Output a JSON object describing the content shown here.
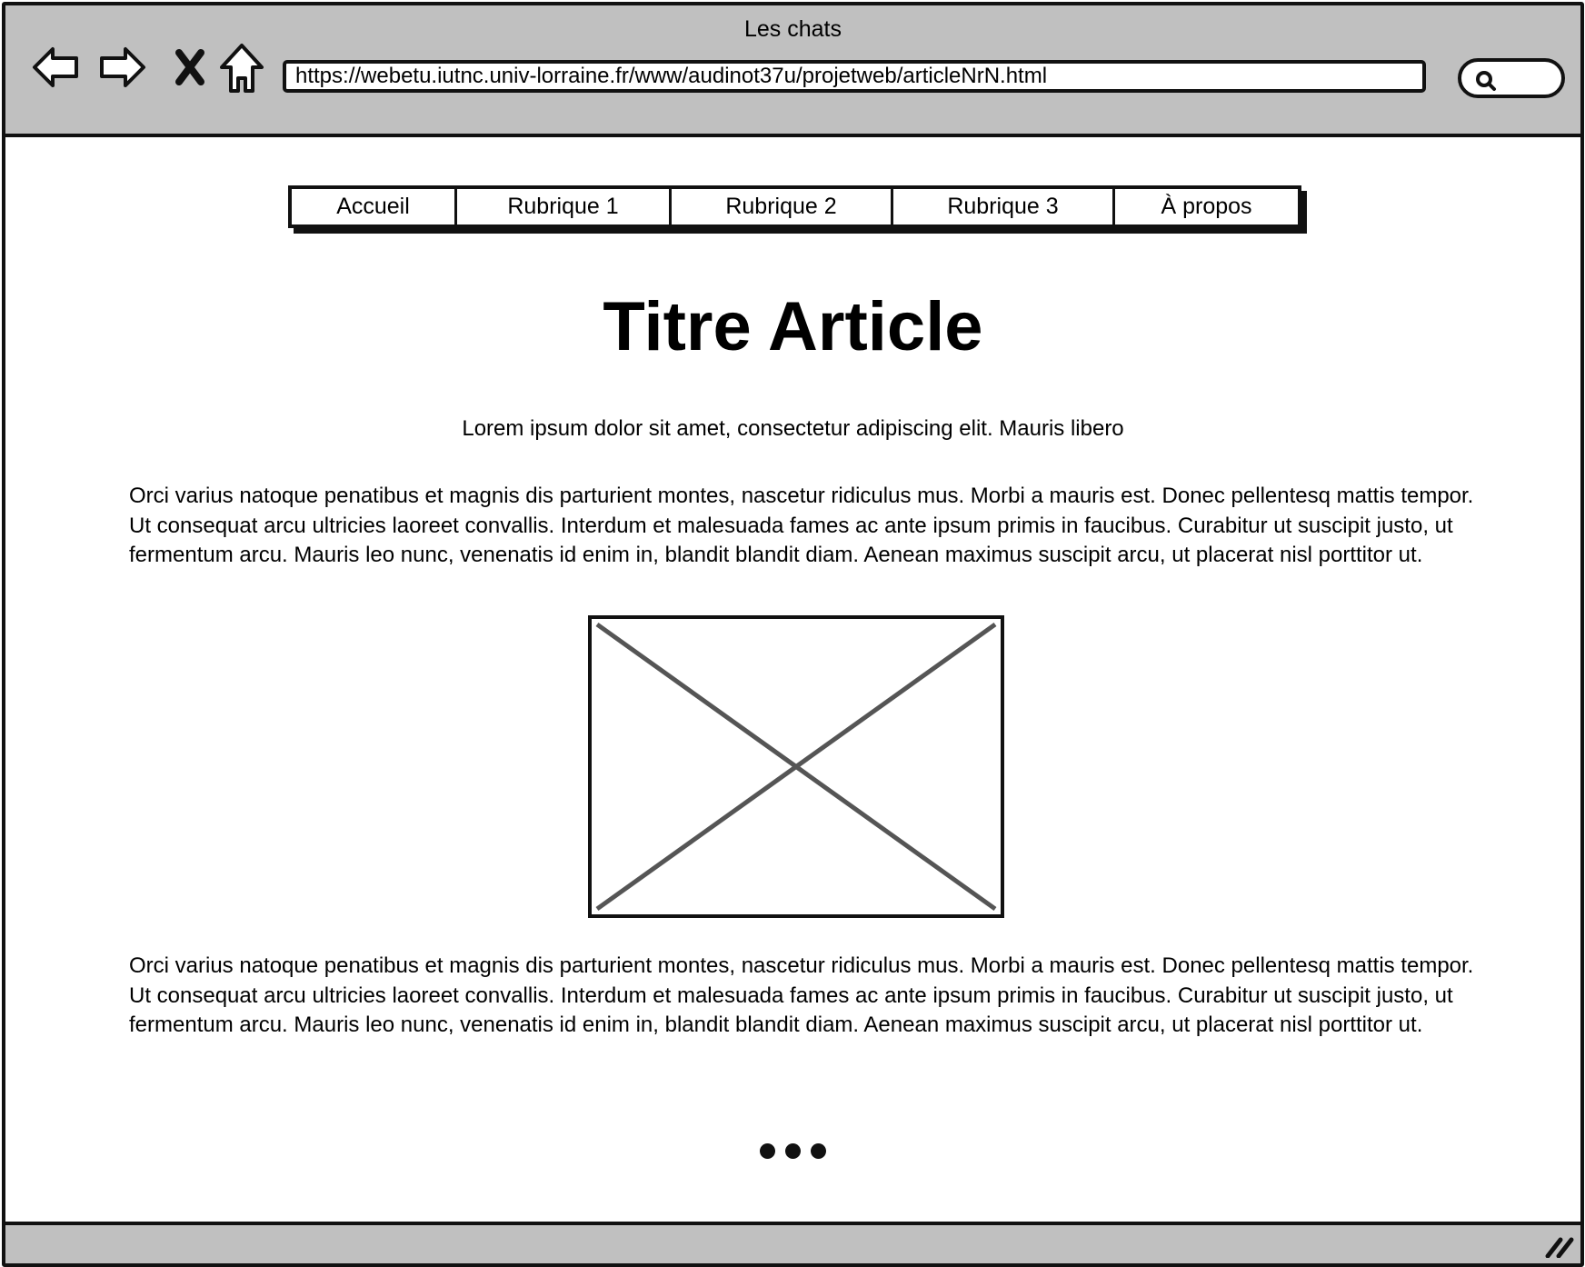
{
  "browser": {
    "window_title": "Les chats",
    "url": "https://webetu.iutnc.univ-lorraine.fr/www/audinot37u/projetweb/articleNrN.html",
    "icons": [
      "back-arrow-icon",
      "forward-arrow-icon",
      "close-icon",
      "home-icon",
      "search-icon",
      "resize-grip-icon"
    ]
  },
  "menu": {
    "items": [
      {
        "label": "Accueil"
      },
      {
        "label": "Rubrique 1"
      },
      {
        "label": "Rubrique 2"
      },
      {
        "label": "Rubrique 3"
      },
      {
        "label": "À propos"
      }
    ]
  },
  "article": {
    "title": "Titre Article",
    "lead": "Lorem ipsum dolor sit amet, consectetur adipiscing elit. Mauris libero",
    "paragraphs": [
      "Orci varius natoque penatibus et magnis dis parturient montes, nascetur ridiculus mus. Morbi a mauris est. Donec pellentesq mattis tempor. Ut consequat arcu ultricies laoreet convallis. Interdum et malesuada fames ac ante ipsum primis in faucibus. Curabitur ut suscipit justo, ut fermentum arcu. Mauris leo nunc, venenatis id enim in, blandit blandit diam. Aenean maximus suscipit arcu, ut placerat nisl porttitor ut.",
      "Orci varius natoque penatibus et magnis dis parturient montes, nascetur ridiculus mus. Morbi a mauris est. Donec pellentesq mattis tempor. Ut consequat arcu ultricies laoreet convallis. Interdum et malesuada fames ac ante ipsum primis in faucibus. Curabitur ut suscipit justo, ut fermentum arcu. Mauris leo nunc, venenatis id enim in, blandit blandit diam. Aenean maximus suscipit arcu, ut placerat nisl porttitor ut."
    ]
  },
  "colors": {
    "chrome": "#c0c0c0",
    "border": "#111111",
    "placeholder_cross": "#555555"
  }
}
